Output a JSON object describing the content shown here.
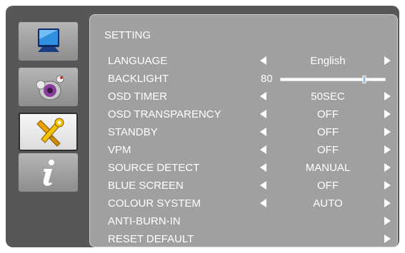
{
  "menu": {
    "title": "SETTING",
    "sidebar": [
      {
        "icon": "monitor-icon",
        "active": false
      },
      {
        "icon": "audio-speaker-icon",
        "active": false
      },
      {
        "icon": "tools-icon",
        "active": true
      },
      {
        "icon": "info-icon",
        "active": false
      }
    ],
    "rows": [
      {
        "label": "LANGUAGE",
        "value": "English",
        "left_arrow": true,
        "right_arrow": true
      },
      {
        "label": "BACKLIGHT",
        "value": "80",
        "type": "slider",
        "level": 0.8
      },
      {
        "label": "OSD TIMER",
        "value": "50SEC",
        "left_arrow": true,
        "right_arrow": true
      },
      {
        "label": "OSD TRANSPARENCY",
        "value": "OFF",
        "left_arrow": true,
        "right_arrow": true
      },
      {
        "label": "STANDBY",
        "value": "OFF",
        "left_arrow": true,
        "right_arrow": true
      },
      {
        "label": "VPM",
        "value": "OFF",
        "left_arrow": true,
        "right_arrow": true
      },
      {
        "label": "SOURCE DETECT",
        "value": "MANUAL",
        "left_arrow": true,
        "right_arrow": true
      },
      {
        "label": "BLUE SCREEN",
        "value": "OFF",
        "left_arrow": true,
        "right_arrow": true
      },
      {
        "label": "COLOUR SYSTEM",
        "value": "AUTO",
        "left_arrow": true,
        "right_arrow": true
      },
      {
        "label": "ANTI-BURN-IN",
        "value": "",
        "left_arrow": false,
        "right_arrow": true
      },
      {
        "label": "RESET DEFAULT",
        "value": "",
        "left_arrow": false,
        "right_arrow": true
      }
    ]
  },
  "colors": {
    "osd_background": "#575757",
    "panel_background": "#a0a0a0",
    "text": "#ffffff",
    "slider_thumb": "#9fb8d4"
  }
}
